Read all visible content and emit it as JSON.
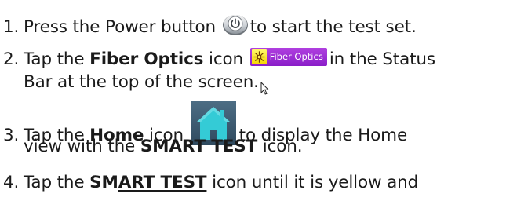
{
  "steps": [
    {
      "number": "1.",
      "before": "Press the Power button",
      "icon": "power-button-icon",
      "after": "to start the test set."
    },
    {
      "number": "2.",
      "before": "Tap the",
      "bold": "Fiber Optics",
      "mid": "icon",
      "icon": "fiber-optics-status-icon",
      "icon_label": "Fiber Optics",
      "after": "in the Status",
      "continuation": "Bar at the top of the screen."
    },
    {
      "number": "3.",
      "before": "Tap the",
      "bold": "Home",
      "mid": "icon",
      "icon": "home-icon",
      "after": "to display the Home",
      "cont_before": "view with the",
      "cont_bold": "SMART TEST",
      "cont_after": "icon."
    },
    {
      "number": "4.",
      "before": "Tap the",
      "bold_a": "SM",
      "bold_b": "ART TEST",
      "after": "icon until it is yellow and"
    }
  ],
  "colors": {
    "text": "#1a1a1a",
    "fiber_icon_bg": "#9a2ed6",
    "fiber_icon_sun": "#f5d400",
    "home_icon_bg": "#3a566c",
    "home_icon_house": "#2dc9d2"
  }
}
